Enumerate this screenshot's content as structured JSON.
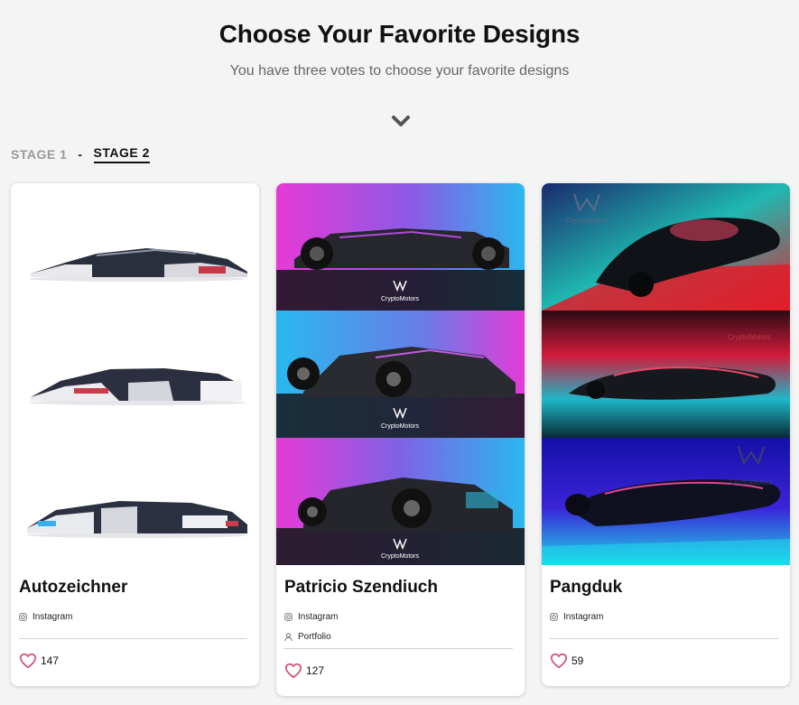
{
  "header": {
    "title": "Choose Your Favorite Designs",
    "subtitle": "You have three votes to choose your favorite designs"
  },
  "stages": {
    "stage1": "STAGE 1",
    "separator": "-",
    "stage2": "STAGE 2",
    "active": "STAGE 2"
  },
  "colors": {
    "heart": "#d6456a",
    "accent": "#111111",
    "inactive": "#999999"
  },
  "cards": [
    {
      "name": "Autozeichner",
      "links": [
        {
          "icon": "instagram-icon",
          "label": "Instagram"
        }
      ],
      "votes": "147"
    },
    {
      "name": "Patricio Szendiuch",
      "links": [
        {
          "icon": "instagram-icon",
          "label": "Instagram"
        },
        {
          "icon": "person-icon",
          "label": "Portfolio"
        }
      ],
      "votes": "127",
      "watermark": "CryptoMotors"
    },
    {
      "name": "Pangduk",
      "links": [
        {
          "icon": "instagram-icon",
          "label": "Instagram"
        }
      ],
      "votes": "59",
      "watermark": "CryptoMotors"
    }
  ]
}
